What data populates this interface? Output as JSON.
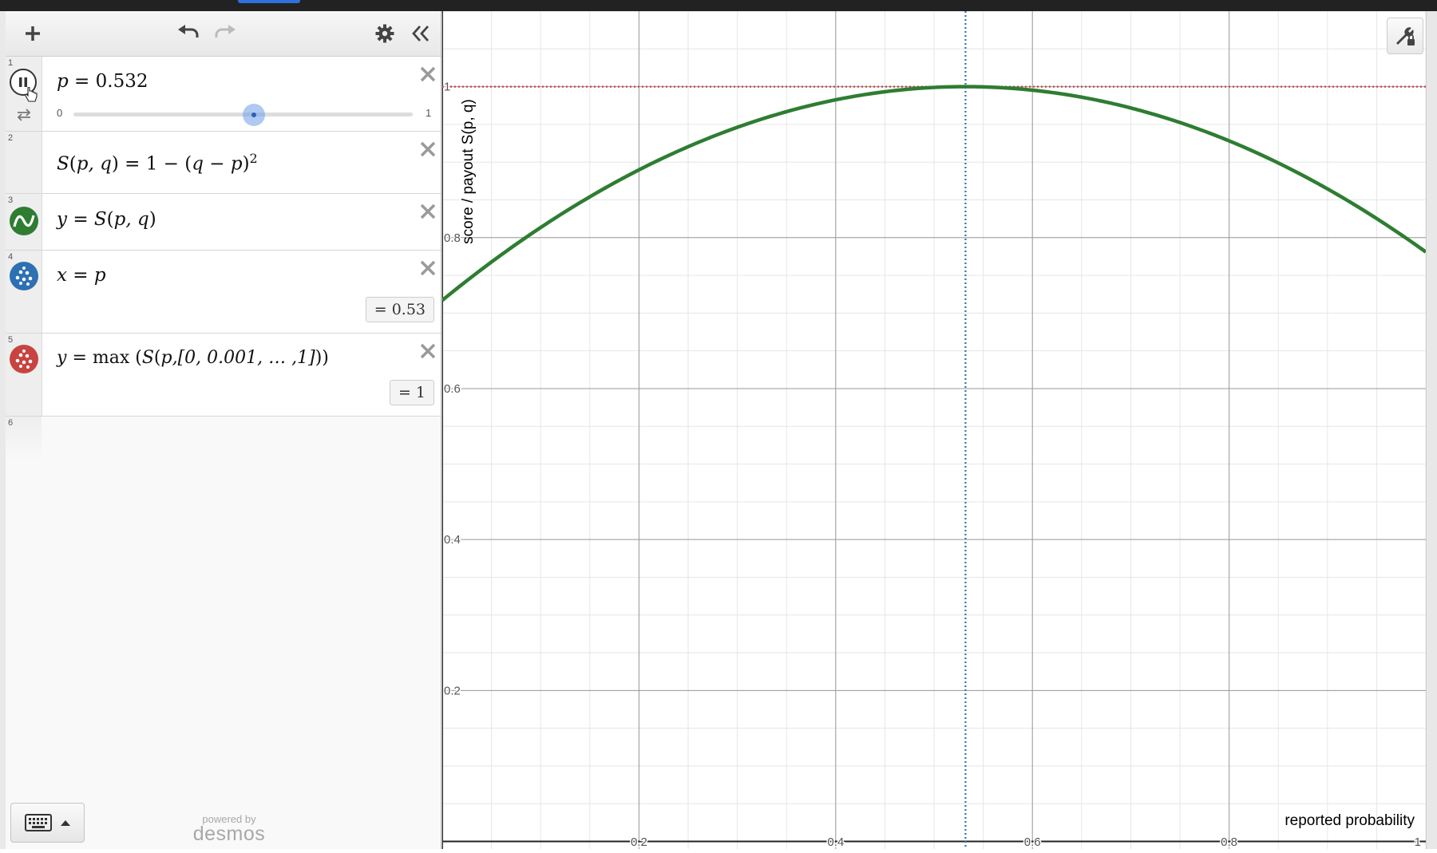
{
  "app": {
    "brand": "desmos",
    "powered_by": "powered by"
  },
  "icons": {
    "add": "plus-icon",
    "undo": "undo-icon",
    "redo": "redo-icon",
    "settings": "gear-icon",
    "collapse": "double-chevron-left-icon",
    "delete": "close-icon",
    "pause": "pause-icon",
    "loop": "loop-icon",
    "keyboard": "keyboard-icon",
    "wrench": "wrench-icon"
  },
  "colors": {
    "green": "#2e7d32",
    "blue": "#2d70b3",
    "red": "#c74440",
    "slider": "#6b9ee8"
  },
  "expressions": [
    {
      "num": "1",
      "lhs": "p",
      "rhs": "= 0.532",
      "slider": {
        "min": "0",
        "max": "1",
        "value": 0.532
      }
    },
    {
      "num": "2",
      "lhs": "S",
      "args": "p, q",
      "rhs": "= 1 − (",
      "rhs2": "q − p",
      "rhs3": ")",
      "exp": "2"
    },
    {
      "num": "3",
      "lhs": "y",
      "rhs": "= ",
      "fn": "S",
      "args": "p, q"
    },
    {
      "num": "4",
      "lhs": "x",
      "rhs": "= ",
      "var": "p",
      "result": "= 0.53"
    },
    {
      "num": "5",
      "lhs": "y",
      "rhs": "= max (",
      "fn": "S",
      "args": "p,[0, 0.001, … ,1]",
      "close": "))",
      "result": "= 1"
    },
    {
      "num": "6"
    }
  ],
  "graph": {
    "xlabel": "reported probability",
    "ylabel": "score / payout S(p, q)",
    "x_ticks": [
      "0.2",
      "0.4",
      "0.6",
      "0.8",
      "1"
    ],
    "y_ticks": [
      "1",
      "0.8",
      "0.6",
      "0.4",
      "0.2"
    ],
    "xlim": [
      0.0,
      1.0
    ],
    "ylim": [
      -0.01,
      1.1
    ],
    "p": 0.532,
    "max_score": 1
  }
}
